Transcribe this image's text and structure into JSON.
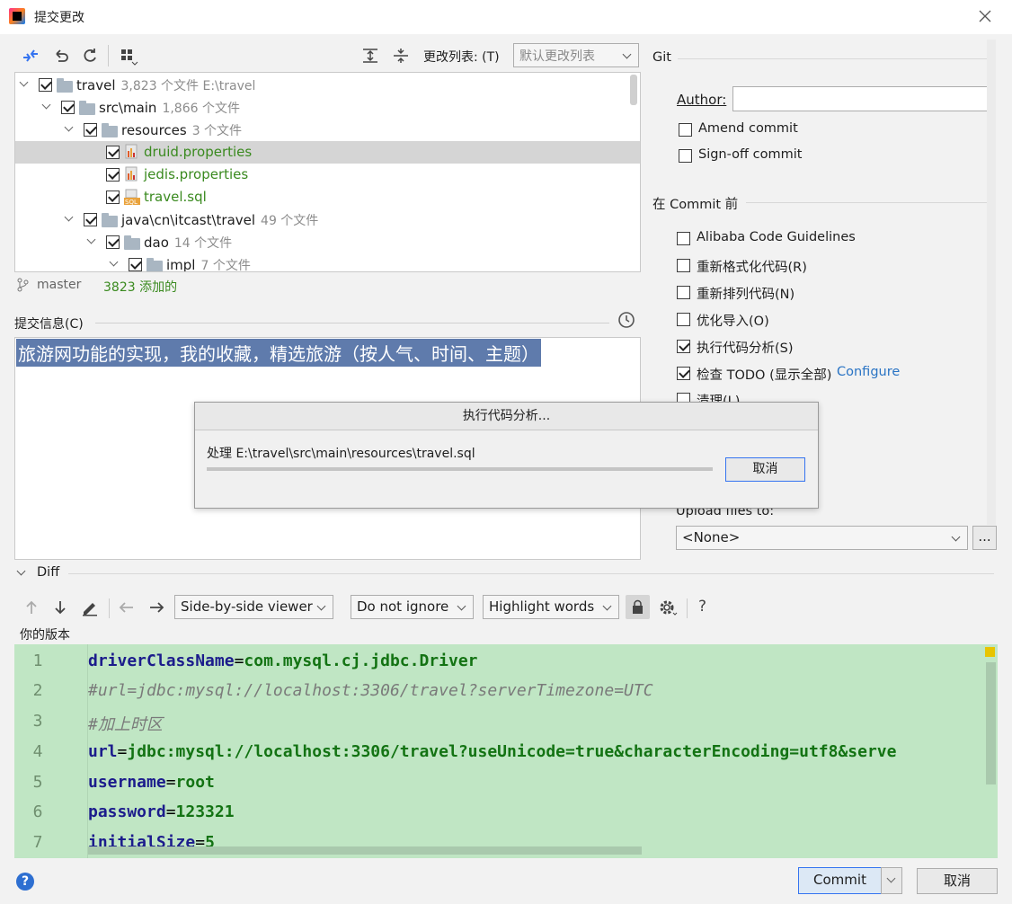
{
  "window": {
    "title": "提交更改"
  },
  "toolbar": {
    "changelist_label": "更改列表: (T)",
    "changelist_value": "默认更改列表"
  },
  "tree": [
    {
      "name": "travel",
      "meta": "3,823 个文件  E:\\travel"
    },
    {
      "name": "src\\main",
      "meta": "1,866 个文件"
    },
    {
      "name": "resources",
      "meta": "3 个文件"
    },
    {
      "name": "druid.properties",
      "meta": ""
    },
    {
      "name": "jedis.properties",
      "meta": ""
    },
    {
      "name": "travel.sql",
      "meta": ""
    },
    {
      "name": "java\\cn\\itcast\\travel",
      "meta": "49 个文件"
    },
    {
      "name": "dao",
      "meta": "14 个文件"
    },
    {
      "name": "impl",
      "meta": "7 个文件"
    }
  ],
  "status": {
    "branch": "master",
    "added": "3823 添加的"
  },
  "commit_message": {
    "label": "提交信息(C)",
    "text": "旅游网功能的实现，我的收藏，精选旅游（按人气、时间、主题）"
  },
  "git": {
    "section": "Git",
    "author_label": "Author:",
    "amend": "Amend commit",
    "signoff": "Sign-off commit"
  },
  "before_commit": {
    "section": "在 Commit 前",
    "options": [
      {
        "label": "Alibaba Code Guidelines",
        "checked": false
      },
      {
        "label": "重新格式化代码(R)",
        "checked": false
      },
      {
        "label": "重新排列代码(N)",
        "checked": false
      },
      {
        "label": "优化导入(O)",
        "checked": false
      },
      {
        "label": "执行代码分析(S)",
        "checked": true
      },
      {
        "label": "检查 TODO (显示全部)",
        "checked": true
      },
      {
        "label": "清理(L)",
        "checked": false
      }
    ],
    "configure_link": "Configure"
  },
  "upload": {
    "label": "Upload files to:",
    "value": "<None>",
    "more": "..."
  },
  "progress_dialog": {
    "title": "执行代码分析...",
    "processing": "处理 E:\\travel\\src\\main\\resources\\travel.sql",
    "cancel": "取消",
    "progress": 0.0
  },
  "diff": {
    "label": "Diff",
    "viewer": "Side-by-side viewer",
    "ignore": "Do not ignore",
    "highlight": "Highlight words",
    "help": "?",
    "version_label": "你的版本",
    "line_numbers": [
      "1",
      "2",
      "3",
      "4",
      "5",
      "6",
      "7"
    ]
  },
  "footer": {
    "commit": "Commit",
    "cancel": "取消"
  }
}
